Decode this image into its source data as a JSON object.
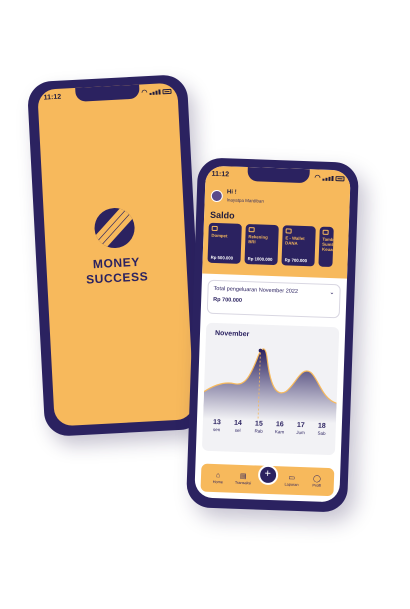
{
  "splash": {
    "time": "11:12",
    "brand_line1": "MONEY",
    "brand_line2": "SUCCESS"
  },
  "app": {
    "time": "11:12",
    "greeting": "Hi !",
    "subtitle": "Inayatpa Mardiban",
    "saldo_label": "Saldo",
    "accounts": [
      {
        "name": "Dompet",
        "amount": "Rp 500.000",
        "icon": "wallet-icon"
      },
      {
        "name": "Rekening BRI",
        "amount": "Rp 1000.000",
        "icon": "bank-icon"
      },
      {
        "name": "E - Wallet DANA",
        "amount": "Rp 700.000",
        "icon": "ewallet-icon"
      },
      {
        "name": "Tambah Sumber Keuangan",
        "amount": "",
        "icon": "plus-icon"
      }
    ],
    "expense_title": "Total pengeluaran November 2022",
    "expense_amount": "Rp 700.000",
    "chart_month": "November",
    "days": [
      {
        "num": "13",
        "label": "sen"
      },
      {
        "num": "14",
        "label": "sel"
      },
      {
        "num": "15",
        "label": "Rab"
      },
      {
        "num": "16",
        "label": "Kam"
      },
      {
        "num": "17",
        "label": "Jum"
      },
      {
        "num": "18",
        "label": "Sab"
      }
    ],
    "nav": [
      {
        "label": "Home",
        "icon": "home-icon"
      },
      {
        "label": "Transaksi",
        "icon": "transaction-icon"
      },
      {
        "label": "Laporan",
        "icon": "report-icon"
      },
      {
        "label": "Profil",
        "icon": "profile-icon"
      }
    ],
    "fab_glyph": "+"
  },
  "colors": {
    "accent": "#f7b95c",
    "dark": "#2b2260"
  }
}
